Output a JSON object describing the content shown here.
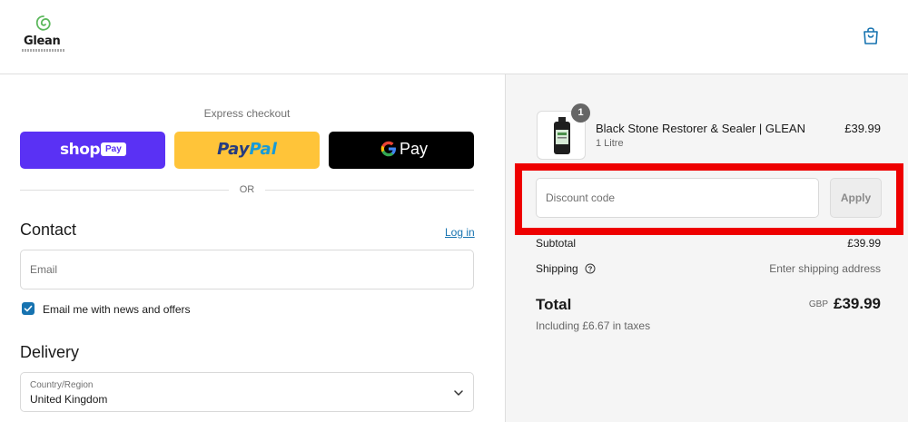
{
  "header": {
    "logo_text": "Glean",
    "cart_icon": "shopping-bag-icon"
  },
  "express": {
    "title": "Express checkout",
    "shop_pay_word": "shop",
    "shop_pay_pill": "Pay",
    "paypal_part1": "Pay",
    "paypal_part2": "Pal",
    "gpay_word": "Pay",
    "or_text": "OR"
  },
  "contact": {
    "title": "Contact",
    "login_link": "Log in",
    "email_placeholder": "Email",
    "newsletter_label": "Email me with news and offers",
    "newsletter_checked": true
  },
  "delivery": {
    "title": "Delivery",
    "country_caption": "Country/Region",
    "country_value": "United Kingdom"
  },
  "summary": {
    "item": {
      "name": "Black Stone Restorer & Sealer | GLEAN",
      "variant": "1 Litre",
      "price": "£39.99",
      "quantity": "1"
    },
    "discount_placeholder": "Discount code",
    "apply_label": "Apply",
    "subtotal_label": "Subtotal",
    "subtotal_value": "£39.99",
    "shipping_label": "Shipping",
    "shipping_value": "Enter shipping address",
    "total_label": "Total",
    "currency": "GBP",
    "total_value": "£39.99",
    "taxes_note": "Including £6.67 in taxes"
  },
  "colors": {
    "accent_link": "#1773b0",
    "shop_pay": "#5a31f4",
    "paypal": "#ffc439",
    "gpay": "#000000",
    "highlight": "#ee0000"
  }
}
